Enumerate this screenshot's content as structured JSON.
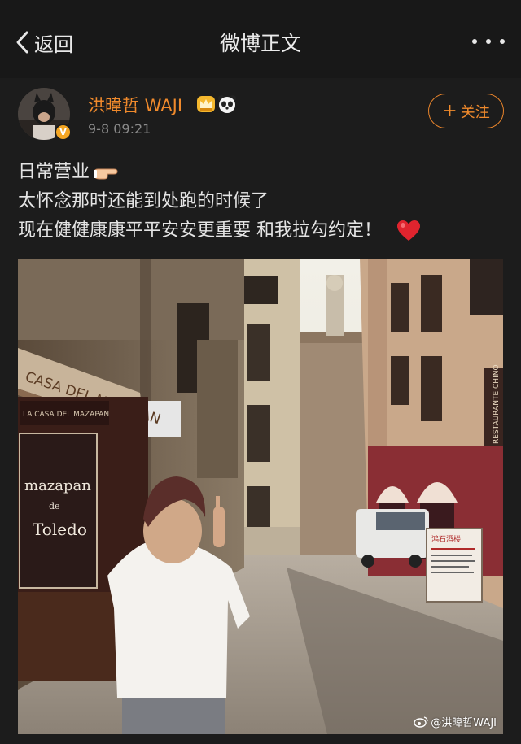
{
  "header": {
    "back_label": "返回",
    "title": "微博正文"
  },
  "post": {
    "author": "洪暐哲 WAJI",
    "timestamp": "9-8 09:21",
    "follow_label": "关注",
    "verified_badge": "V",
    "text_lines": [
      "日常营业",
      "太怀念那时还能到处跑的时候了",
      "现在健健康康平平安安更重要 和我拉勾约定！"
    ],
    "photo": {
      "shop_sign_left": "CASA DEL MAZAPAN",
      "shop_sign_small": "LA CASA DEL MAZAPAN",
      "window_text_1": "mazapan",
      "window_text_2": "de",
      "window_text_3": "Toledo",
      "restaurant_sign": "RESTAURANTE CHINO",
      "menu_board": "鸿石酒楼",
      "watermark": "@洪暐哲WAJI"
    }
  },
  "colors": {
    "accent": "#f08a2c",
    "topbar_bg": "#181818",
    "post_bg": "#1c1c1c"
  }
}
